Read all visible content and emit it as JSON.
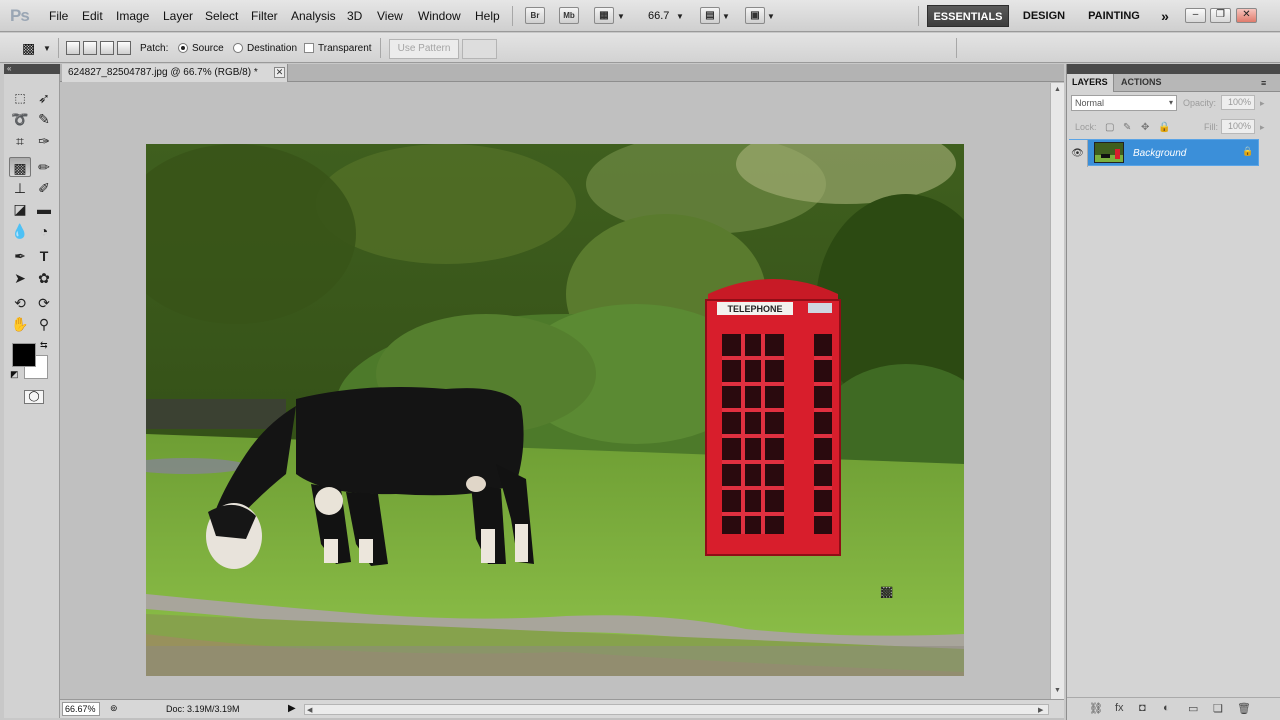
{
  "app": {
    "logo": "Ps",
    "menus": [
      "File",
      "Edit",
      "Image",
      "Layer",
      "Select",
      "Filter",
      "Analysis",
      "3D",
      "View",
      "Window",
      "Help"
    ],
    "bridge_button": "Br",
    "minibridge_button": "Mb",
    "zoom_level": "66.7",
    "workspaces": [
      "ESSENTIALS",
      "DESIGN",
      "PAINTING"
    ],
    "more_workspaces": "»"
  },
  "options": {
    "patch_label": "Patch:",
    "source_label": "Source",
    "destination_label": "Destination",
    "transparent_label": "Transparent",
    "use_pattern_label": "Use Pattern",
    "selected_mode": "Source"
  },
  "document": {
    "tab_title": "624827_82504787.jpg @ 66.7% (RGB/8) *",
    "zoom_percent": "66.67%",
    "doc_size": "Doc: 3.19M/3.19M",
    "sign_text": "TELEPHONE"
  },
  "layers_panel": {
    "tabs": [
      "LAYERS",
      "ACTIONS"
    ],
    "blend_mode": "Normal",
    "opacity_label": "Opacity:",
    "opacity_value": "100%",
    "lock_label": "Lock:",
    "fill_label": "Fill:",
    "fill_value": "100%",
    "layers": [
      {
        "name": "Background",
        "selected": true,
        "locked": true,
        "visible": true
      }
    ]
  },
  "colors": {
    "accent": "#3b8fd9",
    "foreground": "#000000",
    "background": "#ffffff",
    "phonebox_red": "#d81e2c"
  }
}
